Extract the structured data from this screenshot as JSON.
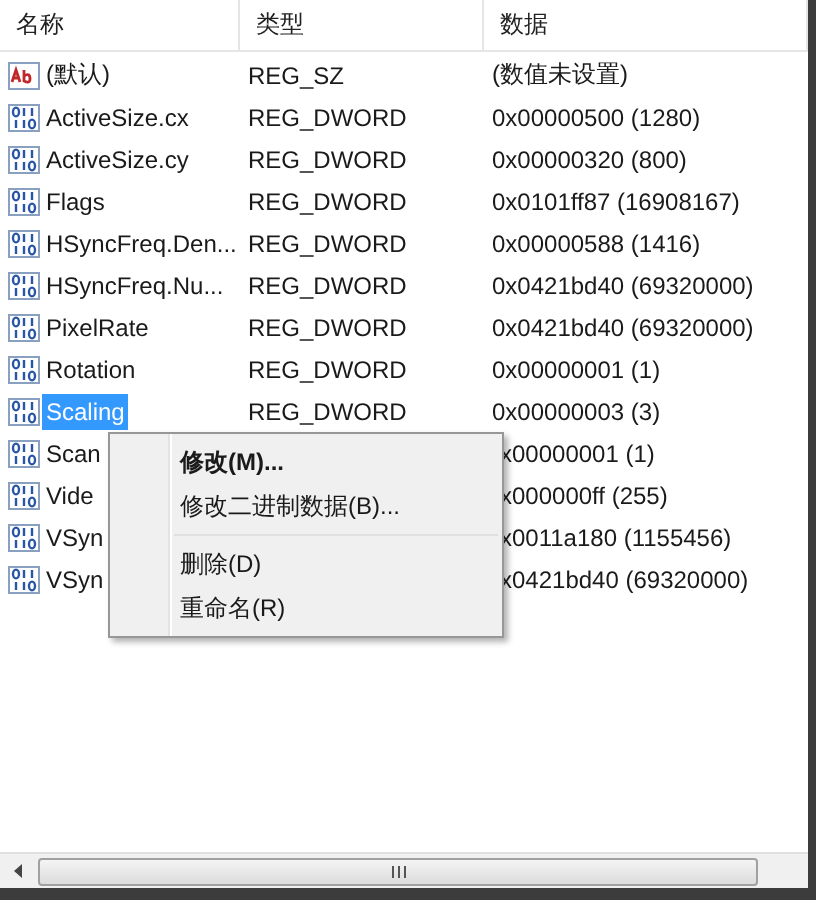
{
  "columns": [
    "名称",
    "类型",
    "数据"
  ],
  "rows": [
    {
      "kind": "string",
      "name": "(默认)",
      "type": "REG_SZ",
      "data": "(数值未设置)",
      "selected": false
    },
    {
      "kind": "dword",
      "name": "ActiveSize.cx",
      "type": "REG_DWORD",
      "data": "0x00000500 (1280)",
      "selected": false
    },
    {
      "kind": "dword",
      "name": "ActiveSize.cy",
      "type": "REG_DWORD",
      "data": "0x00000320 (800)",
      "selected": false
    },
    {
      "kind": "dword",
      "name": "Flags",
      "type": "REG_DWORD",
      "data": "0x0101ff87 (16908167)",
      "selected": false
    },
    {
      "kind": "dword",
      "name": "HSyncFreq.Den...",
      "type": "REG_DWORD",
      "data": "0x00000588 (1416)",
      "selected": false
    },
    {
      "kind": "dword",
      "name": "HSyncFreq.Nu...",
      "type": "REG_DWORD",
      "data": "0x0421bd40 (69320000)",
      "selected": false
    },
    {
      "kind": "dword",
      "name": "PixelRate",
      "type": "REG_DWORD",
      "data": "0x0421bd40 (69320000)",
      "selected": false
    },
    {
      "kind": "dword",
      "name": "Rotation",
      "type": "REG_DWORD",
      "data": "0x00000001 (1)",
      "selected": false
    },
    {
      "kind": "dword",
      "name": "Scaling",
      "type": "REG_DWORD",
      "data": "0x00000003 (3)",
      "selected": true
    },
    {
      "kind": "dword",
      "name": "Scan",
      "data": "x00000001 (1)",
      "selected": false
    },
    {
      "kind": "dword",
      "name": "Vide",
      "data": "x000000ff (255)",
      "selected": false
    },
    {
      "kind": "dword",
      "name": "VSyn",
      "data": "x0011a180 (1155456)",
      "selected": false
    },
    {
      "kind": "dword",
      "name": "VSyn",
      "data": "x0421bd40 (69320000)",
      "selected": false
    }
  ],
  "context_menu": [
    {
      "kind": "item",
      "label": "修改(M)...",
      "default": true
    },
    {
      "kind": "item",
      "label": "修改二进制数据(B)...",
      "default": false
    },
    {
      "kind": "separator"
    },
    {
      "kind": "item",
      "label": "删除(D)",
      "default": false
    },
    {
      "kind": "item",
      "label": "重命名(R)",
      "default": false
    }
  ]
}
